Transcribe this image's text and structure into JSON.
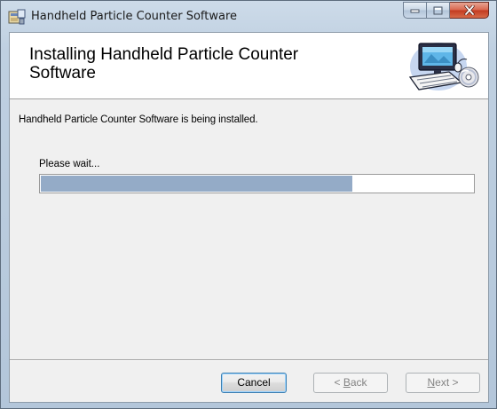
{
  "window": {
    "title": "Handheld Particle Counter Software",
    "controls": {
      "minimize_icon": "minimize-icon",
      "maximize_icon": "maximize-icon",
      "close_icon": "close-icon"
    }
  },
  "banner": {
    "title": "Installing Handheld Particle Counter Software",
    "graphic_icon": "computer-installer-icon"
  },
  "body": {
    "status": "Handheld Particle Counter Software is being installed.",
    "wait_label": "Please wait..."
  },
  "progress": {
    "fraction": 0.72,
    "color": "#94abc7"
  },
  "buttons": {
    "cancel": "Cancel",
    "back_prefix": "< ",
    "back_mnemonic": "B",
    "back_rest": "ack",
    "next_mnemonic": "N",
    "next_rest": "ext >"
  },
  "colors": {
    "close_red": "#c33a20",
    "focus_blue": "#3c7fb1"
  }
}
